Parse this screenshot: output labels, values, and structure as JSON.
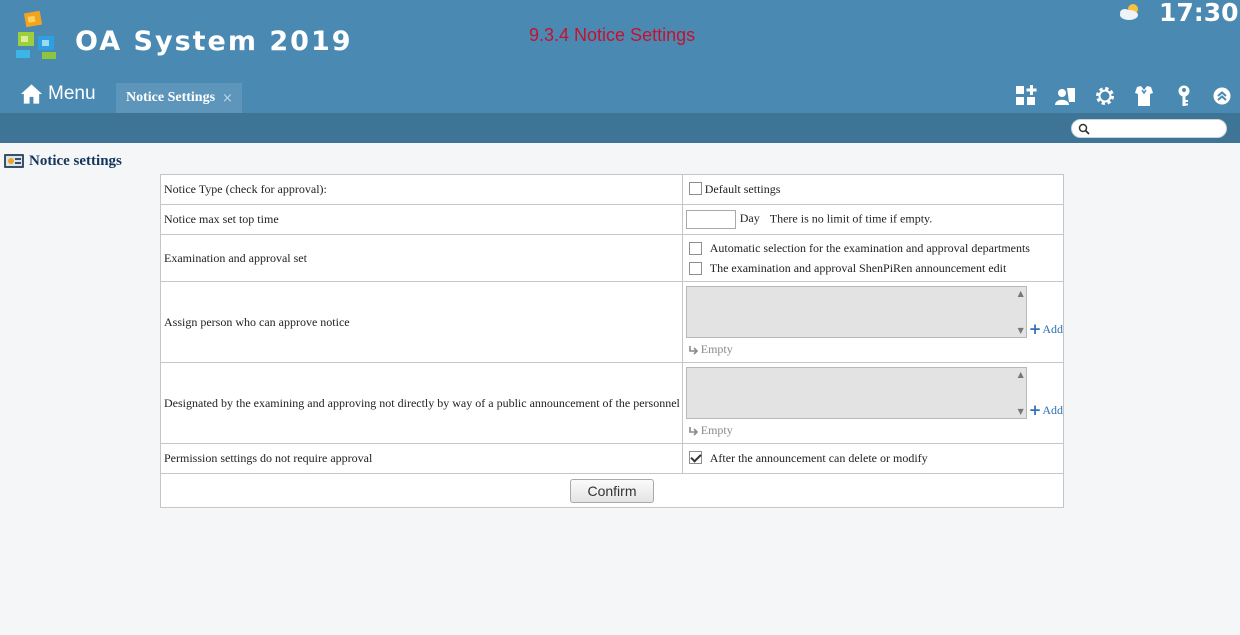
{
  "header": {
    "app_title": "OA System 2019",
    "center_caption": "9.3.4 Notice Settings",
    "clock": "17:30",
    "weather_icon": "partly-cloudy-icon",
    "colors": {
      "header_bg": "#4a8ab2",
      "subbar_bg": "#3e7596",
      "caption": "#c8102e"
    }
  },
  "nav": {
    "menu_label": "Menu",
    "tab_label": "Notice Settings",
    "tab_close": "×",
    "toolbar_icons": [
      "add-module-icon",
      "user-skin-icon",
      "gear-icon",
      "shirt-icon",
      "key-icon",
      "collapse-up-icon"
    ]
  },
  "search": {
    "placeholder": "",
    "value": ""
  },
  "page": {
    "section_title": "Notice settings",
    "rows": [
      {
        "label": "Notice Type (check for approval):",
        "checkbox_label": "Default settings",
        "checked": false
      },
      {
        "label": "Notice max set top time",
        "input_value": "",
        "unit": "Day",
        "hint": "There is no limit of time if empty."
      },
      {
        "label": "Examination and approval set",
        "options": [
          {
            "label": "Automatic selection for the examination and approval departments",
            "checked": false
          },
          {
            "label": "The examination and approval ShenPiRen announcement edit",
            "checked": false
          }
        ]
      },
      {
        "label": "Assign person who can approve notice",
        "add_label": "Add",
        "empty_label": "Empty"
      },
      {
        "label": "Designated by the examining and approving not directly by way of a public announcement of the personnel",
        "add_label": "Add",
        "empty_label": "Empty"
      },
      {
        "label": "Permission settings do not require approval",
        "checkbox_label": "After the announcement can delete or modify",
        "checked": true
      }
    ],
    "confirm_label": "Confirm"
  }
}
